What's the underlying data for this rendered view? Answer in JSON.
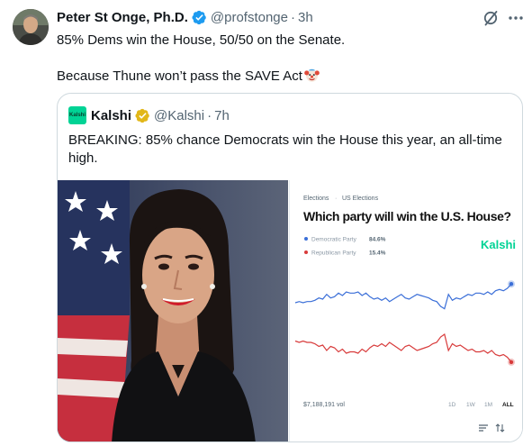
{
  "tweet": {
    "author_name": "Peter St Onge, Ph.D.",
    "handle": "@profstonge",
    "separator": "·",
    "time": "3h",
    "text_line1": "85% Dems win the House, 50/50 on the Senate.",
    "text_line2": "Because Thune won’t pass the SAVE Act",
    "emoji_icon": "clown-face-icon"
  },
  "quote": {
    "avatar_text": "Kalshi",
    "author_name": "Kalshi",
    "handle": "@Kalshi",
    "separator": "·",
    "time": "7h",
    "text": "BREAKING: 85% chance Democrats win the House this year, an all-time high."
  },
  "chart_data": {
    "type": "line",
    "breadcrumb": [
      "Elections",
      "US Elections"
    ],
    "breadcrumb_separator": "·",
    "title": "Which party will win the U.S. House?",
    "brand": "Kalshi",
    "volume": "$7,188,191 vol",
    "time_ranges": [
      "1D",
      "1W",
      "1M",
      "ALL"
    ],
    "selected_range": "ALL",
    "ylim": [
      0,
      100
    ],
    "series": [
      {
        "name": "Democratic Party",
        "label_value": "84.6%",
        "color": "#3b6fd8",
        "values": [
          69,
          70,
          69,
          70,
          70,
          71,
          73,
          72,
          76,
          73,
          74,
          77,
          75,
          78,
          77,
          77,
          78,
          75,
          77,
          74,
          72,
          73,
          71,
          73,
          70,
          72,
          74,
          76,
          73,
          72,
          74,
          76,
          75,
          74,
          73,
          71,
          70,
          66,
          64,
          76,
          71,
          73,
          72,
          74,
          76,
          75,
          77,
          77,
          76,
          78,
          76,
          79,
          80,
          79,
          81,
          84.6
        ]
      },
      {
        "name": "Republican Party",
        "label_value": "15.4%",
        "color": "#d83b3b",
        "values": [
          31,
          30,
          31,
          30,
          30,
          29,
          27,
          28,
          24,
          27,
          26,
          23,
          25,
          22,
          23,
          23,
          22,
          25,
          23,
          26,
          28,
          27,
          29,
          27,
          30,
          28,
          26,
          24,
          27,
          28,
          26,
          24,
          25,
          26,
          27,
          29,
          30,
          34,
          36,
          24,
          29,
          27,
          28,
          26,
          24,
          25,
          23,
          23,
          24,
          22,
          24,
          21,
          20,
          21,
          19,
          15.4
        ]
      }
    ]
  },
  "icons": {
    "verified": "verified-badge-icon",
    "grok": "grok-icon",
    "more": "more-options-icon",
    "sort": "filter-lines-icon",
    "swap": "swap-arrows-icon"
  },
  "colors": {
    "verified_blue": "#1d9bf0",
    "business_gold": "#e2b719",
    "kalshi_green": "#00d395",
    "secondary_text": "#536471"
  }
}
